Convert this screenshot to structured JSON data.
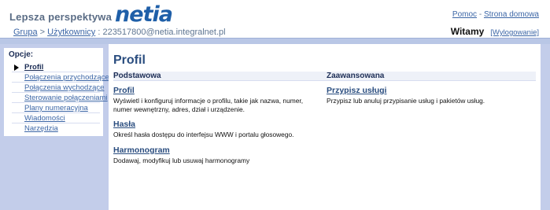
{
  "header": {
    "tagline": "Lepsza perspektywa",
    "logo_text": "netia",
    "breadcrumb": {
      "group": "Grupa",
      "separator": ">",
      "users": "Użytkownicy",
      "account": "223517800@netia.integralnet.pl"
    },
    "top_links": {
      "help": "Pomoc",
      "dash": "-",
      "home": "Strona domowa"
    },
    "welcome": "Witamy",
    "logout": "[Wylogowanie]"
  },
  "sidebar": {
    "heading": "Opcje:",
    "items": [
      {
        "label": "Profil",
        "active": true
      },
      {
        "label": "Połączenia przychodzące",
        "active": false
      },
      {
        "label": "Połączenia wychodzące",
        "active": false
      },
      {
        "label": "Sterowanie połączeniami",
        "active": false
      },
      {
        "label": "Plany numeracyjna",
        "active": false
      },
      {
        "label": "Wiadomości",
        "active": false
      },
      {
        "label": "Narzędzia",
        "active": false
      }
    ]
  },
  "main": {
    "title": "Profil",
    "columns": {
      "left": "Podstawowa",
      "right": "Zaawansowana"
    },
    "basic": [
      {
        "link": "Profil",
        "desc": "Wyświetl i konfiguruj informacje o profilu, takie jak nazwa, numer, numer wewnętrzny, adres, dział i urządzenie."
      },
      {
        "link": "Hasła",
        "desc": "Określ hasła dostępu do interfejsu WWW i portalu głosowego."
      },
      {
        "link": "Harmonogram",
        "desc": "Dodawaj, modyfikuj lub usuwaj harmonogramy"
      }
    ],
    "advanced": [
      {
        "link": "Przypisz usługi",
        "desc": "Przypisz lub anuluj przypisanie usług i pakietów usług."
      }
    ]
  },
  "colors": {
    "brand_blue": "#1f5fa8",
    "link_blue": "#3c66a6",
    "band": "#b9c7e6",
    "sidebar_bg": "#c3cdea"
  }
}
